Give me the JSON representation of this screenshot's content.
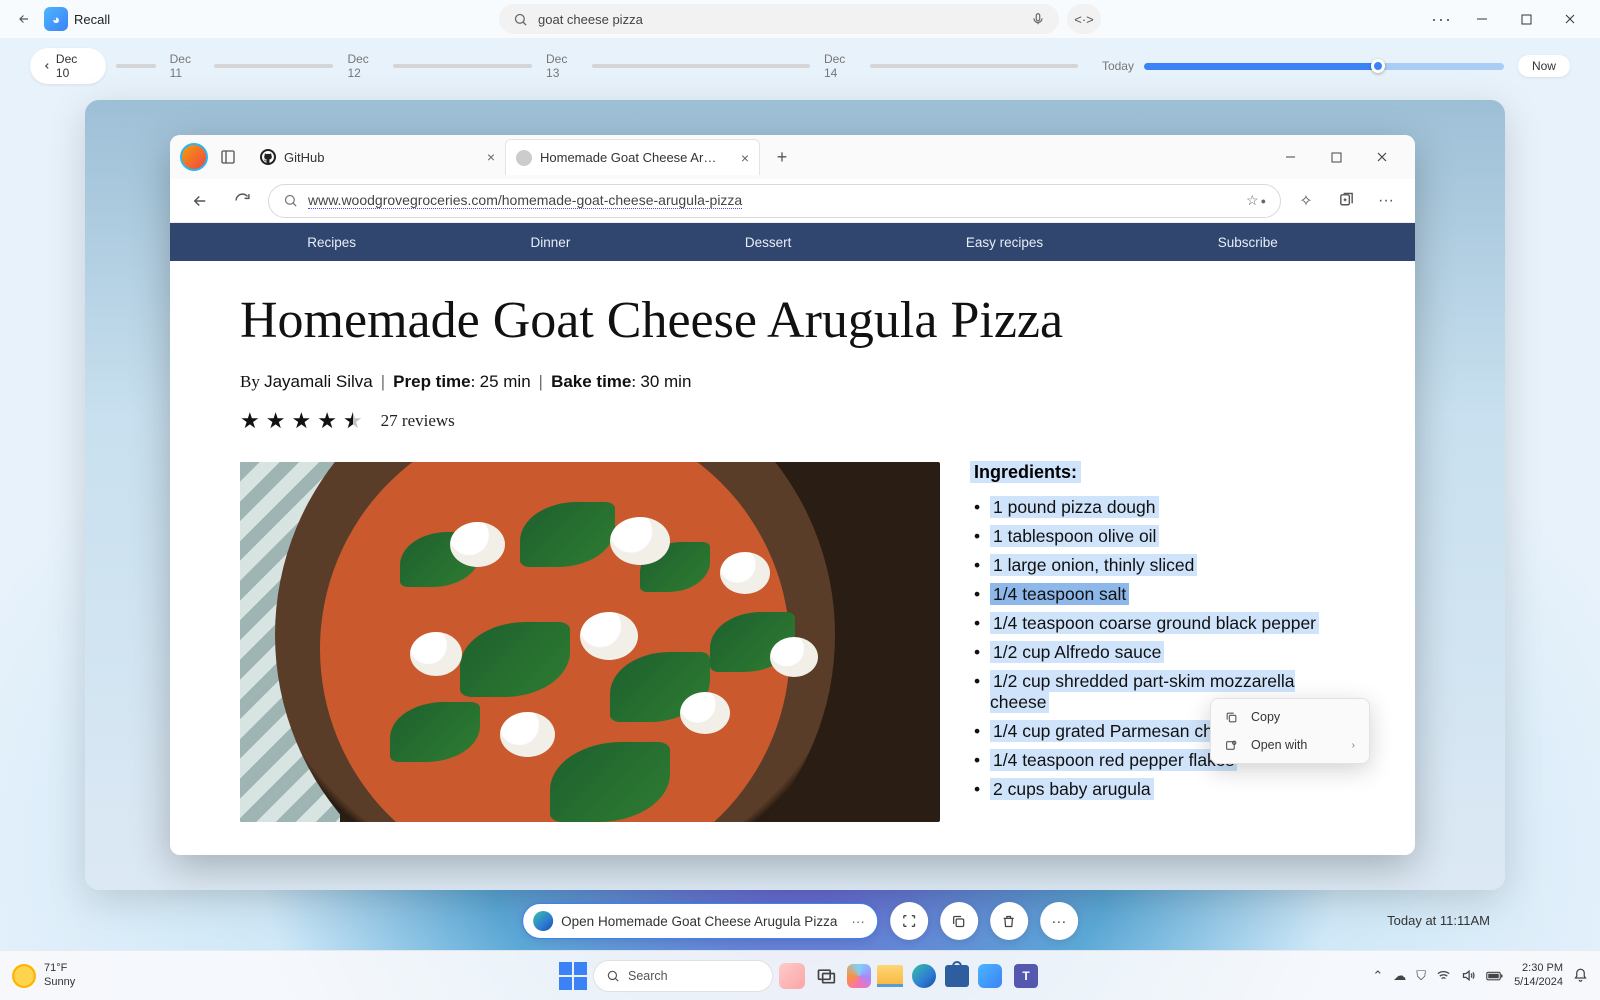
{
  "recall": {
    "app_title": "Recall",
    "search_query": "goat cheese pizza",
    "timeline": {
      "start_label": "Dec 10",
      "segments": [
        "Dec 11",
        "Dec 12",
        "Dec 13",
        "Dec 14"
      ],
      "today_label": "Today",
      "now_label": "Now"
    },
    "snapshot_time": "Today at 11:11AM"
  },
  "browser": {
    "tabs": [
      {
        "title": "GitHub",
        "active": false
      },
      {
        "title": "Homemade Goat Cheese Arugula Pizz",
        "active": true
      }
    ],
    "url": "www.woodgrovegroceries.com/homemade-goat-cheese-arugula-pizza"
  },
  "site_nav": [
    "Recipes",
    "Dinner",
    "Dessert",
    "Easy recipes",
    "Subscribe"
  ],
  "recipe": {
    "title": "Homemade Goat Cheese Arugula Pizza",
    "author": "Jayamali Silva",
    "prep_label": "Prep time",
    "prep_value": "25 min",
    "bake_label": "Bake time",
    "bake_value": "30 min",
    "reviews": "27 reviews",
    "ingredients_header": "Ingredients:",
    "ingredients": [
      "1 pound pizza dough",
      "1 tablespoon olive oil",
      "1 large onion, thinly sliced",
      "1/4 teaspoon salt",
      "1/4 teaspoon coarse ground black pepper",
      "1/2 cup Alfredo sauce",
      "1/2 cup shredded part-skim mozzarella cheese",
      "1/4 cup grated Parmesan cheese",
      "1/4 teaspoon red pepper flakes",
      "2 cups baby arugula"
    ]
  },
  "context_menu": {
    "copy": "Copy",
    "open_with": "Open with"
  },
  "action_bar": {
    "open_label": "Open Homemade Goat Cheese Arugula Pizza"
  },
  "taskbar": {
    "weather_temp": "71°F",
    "weather_desc": "Sunny",
    "search_placeholder": "Search",
    "time": "2:30 PM",
    "date": "5/14/2024"
  }
}
